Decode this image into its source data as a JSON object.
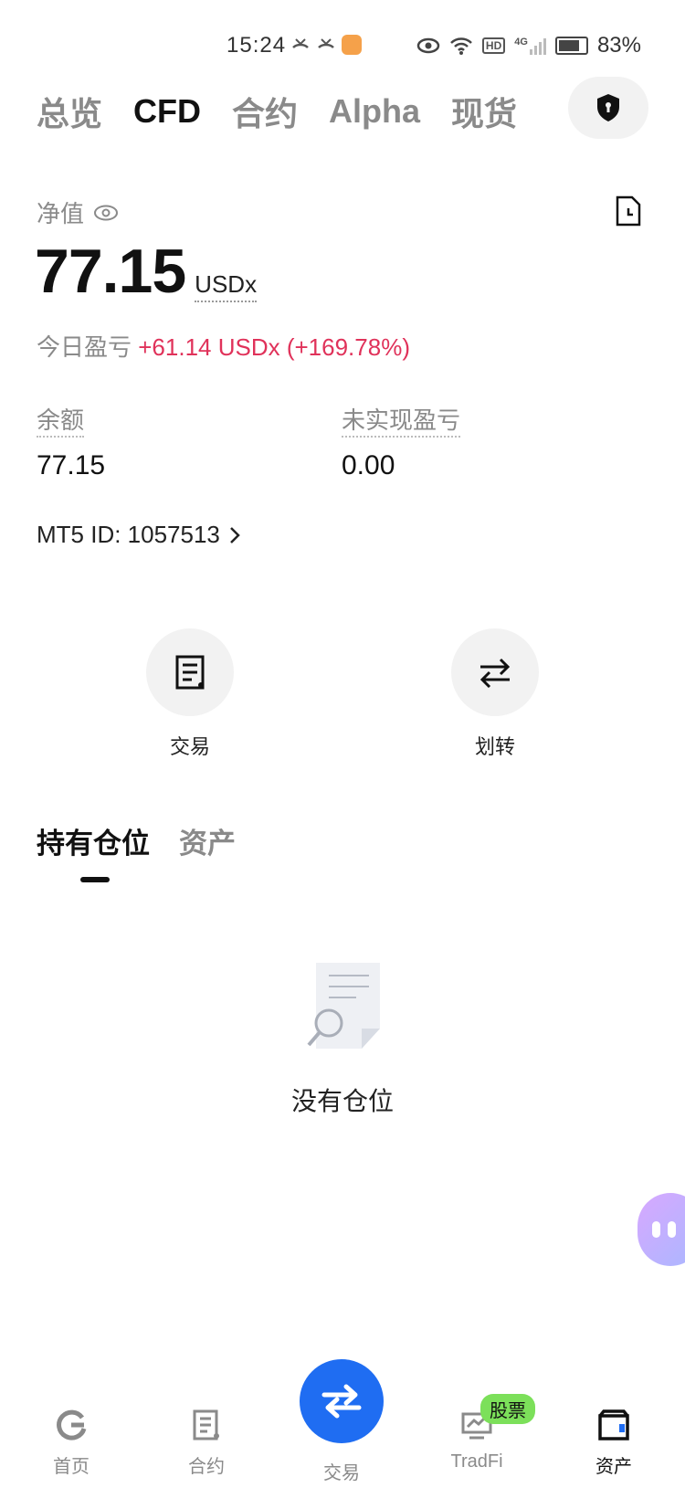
{
  "status_bar": {
    "time": "15:24",
    "signal_label": "4G",
    "hd_label": "HD",
    "battery": "83%"
  },
  "top_tabs": [
    {
      "label": "总览",
      "active": false
    },
    {
      "label": "CFD",
      "active": true
    },
    {
      "label": "合约",
      "active": false
    },
    {
      "label": "Alpha",
      "active": false
    },
    {
      "label": "现货",
      "active": false
    }
  ],
  "account": {
    "net_value_label": "净值",
    "net_value": "77.15",
    "net_value_unit": "USDx",
    "today_pnl_label": "今日盈亏",
    "today_pnl_value": "+61.14 USDx (+169.78%)",
    "balance_label": "余额",
    "balance_value": "77.15",
    "unrealized_label": "未实现盈亏",
    "unrealized_value": "0.00",
    "mt5_id": "MT5 ID: 1057513"
  },
  "actions": [
    {
      "label": "交易",
      "icon": "document-icon"
    },
    {
      "label": "划转",
      "icon": "transfer-icon"
    }
  ],
  "sub_tabs": [
    {
      "label": "持有仓位",
      "active": true
    },
    {
      "label": "资产",
      "active": false
    }
  ],
  "empty_state": {
    "text": "没有仓位"
  },
  "bottom_nav": {
    "home": "首页",
    "contracts": "合约",
    "trade": "交易",
    "tradfi": "TradFi",
    "tradfi_badge": "股票",
    "assets": "资产",
    "active": "assets"
  },
  "colors": {
    "accent": "#1f6df2",
    "positive": "#e0325a",
    "badge": "#7ce05a"
  }
}
